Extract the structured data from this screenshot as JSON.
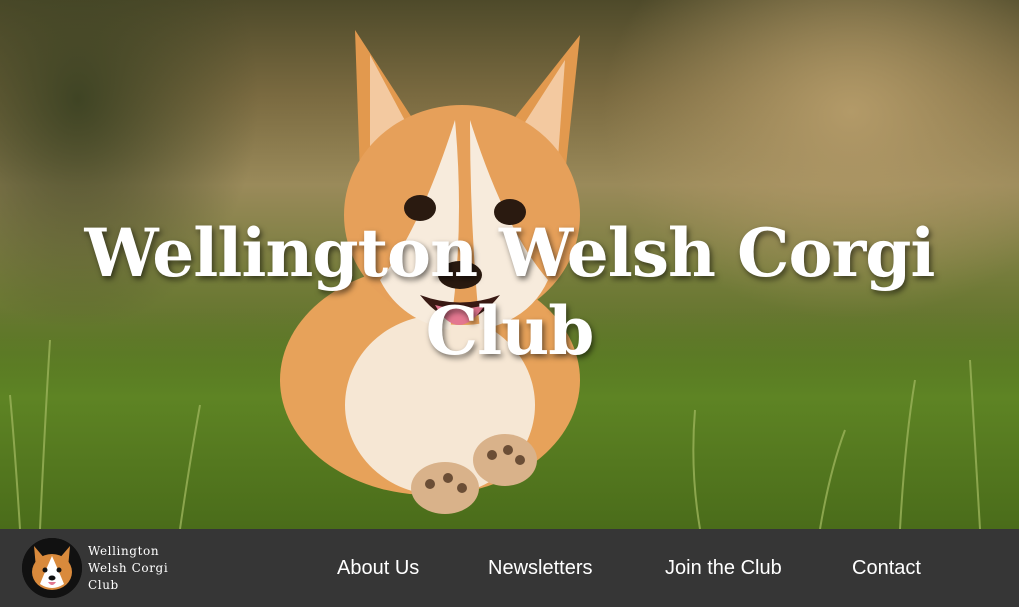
{
  "hero": {
    "title": "Wellington Welsh Corgi Club"
  },
  "brand": {
    "name": "Wellington Welsh Corgi Club",
    "logo_icon": "corgi-icon"
  },
  "nav": {
    "items": [
      {
        "label": "About Us"
      },
      {
        "label": "Newsletters"
      },
      {
        "label": "Join the Club"
      },
      {
        "label": "Contact"
      }
    ]
  },
  "colors": {
    "navbar_bg": "#363636",
    "text": "#ffffff",
    "corgi_orange": "#d98a3c"
  }
}
